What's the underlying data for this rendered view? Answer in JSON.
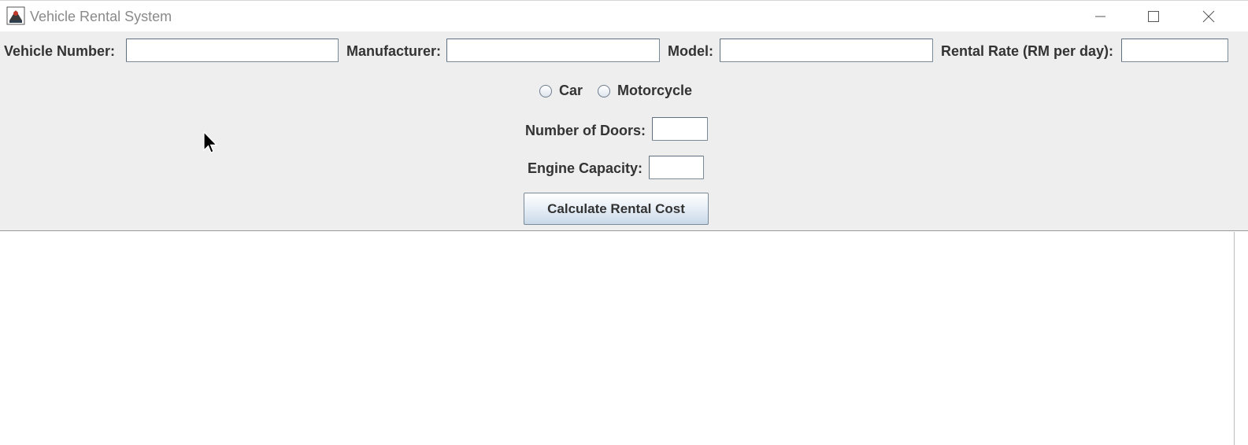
{
  "window": {
    "title": "Vehicle Rental System",
    "icons": {
      "app": "java-icon",
      "minimize": "minimize-icon",
      "maximize": "maximize-icon",
      "close": "close-icon"
    }
  },
  "form": {
    "vehicle_number": {
      "label": "Vehicle Number:",
      "value": ""
    },
    "manufacturer": {
      "label": "Manufacturer:",
      "value": ""
    },
    "model": {
      "label": "Model:",
      "value": ""
    },
    "rental_rate": {
      "label": "Rental Rate (RM per day):",
      "value": ""
    },
    "vehicle_type": {
      "options": [
        {
          "label": "Car",
          "selected": false
        },
        {
          "label": "Motorcycle",
          "selected": false
        }
      ]
    },
    "number_of_doors": {
      "label": "Number of Doors:",
      "value": ""
    },
    "engine_capacity": {
      "label": "Engine Capacity:",
      "value": ""
    },
    "calculate_button": {
      "label": "Calculate Rental Cost"
    }
  },
  "output": {
    "text": ""
  },
  "colors": {
    "panel_bg": "#eeeeee",
    "text": "#333333",
    "title_text": "#8a8a8a"
  }
}
